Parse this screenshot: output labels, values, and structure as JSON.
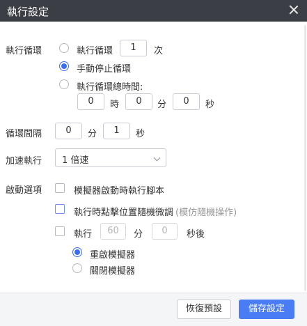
{
  "window": {
    "title": "執行設定"
  },
  "loop": {
    "section_label": "執行循環",
    "opt_count_label": "執行循環",
    "count_value": "1",
    "count_unit": "次",
    "opt_manual_label": "手動停止循環",
    "opt_duration_label": "執行循環總時間:",
    "hours_value": "0",
    "hours_unit": "時",
    "minutes_value": "0",
    "minutes_unit": "分",
    "seconds_value": "0",
    "seconds_unit": "秒",
    "selected": "manual"
  },
  "interval": {
    "label": "循環間隔",
    "minutes_value": "0",
    "minutes_unit": "分",
    "seconds_value": "1",
    "seconds_unit": "秒"
  },
  "speed": {
    "label": "加速執行",
    "selected": "1 倍速"
  },
  "startup": {
    "label": "啟動選項",
    "run_on_emulator_start": "模擬器啟動時執行腳本",
    "random_tap_offset": "執行時點擊位置隨機微調",
    "random_tap_hint": "(模仿隨機操作)",
    "timer_label": "執行",
    "timer_minutes_value": "60",
    "timer_minutes_unit": "分",
    "timer_seconds_value": "0",
    "timer_suffix": "秒後",
    "restart_label": "重啟模擬器",
    "close_label": "關閉模擬器"
  },
  "buttons": {
    "reset": "恢復預設",
    "save": "儲存設定"
  },
  "colors": {
    "titlebar": "#3b3e45",
    "accent": "#3b6df5",
    "primary_button": "#4a7cf6",
    "footer": "#f4f5f7"
  }
}
